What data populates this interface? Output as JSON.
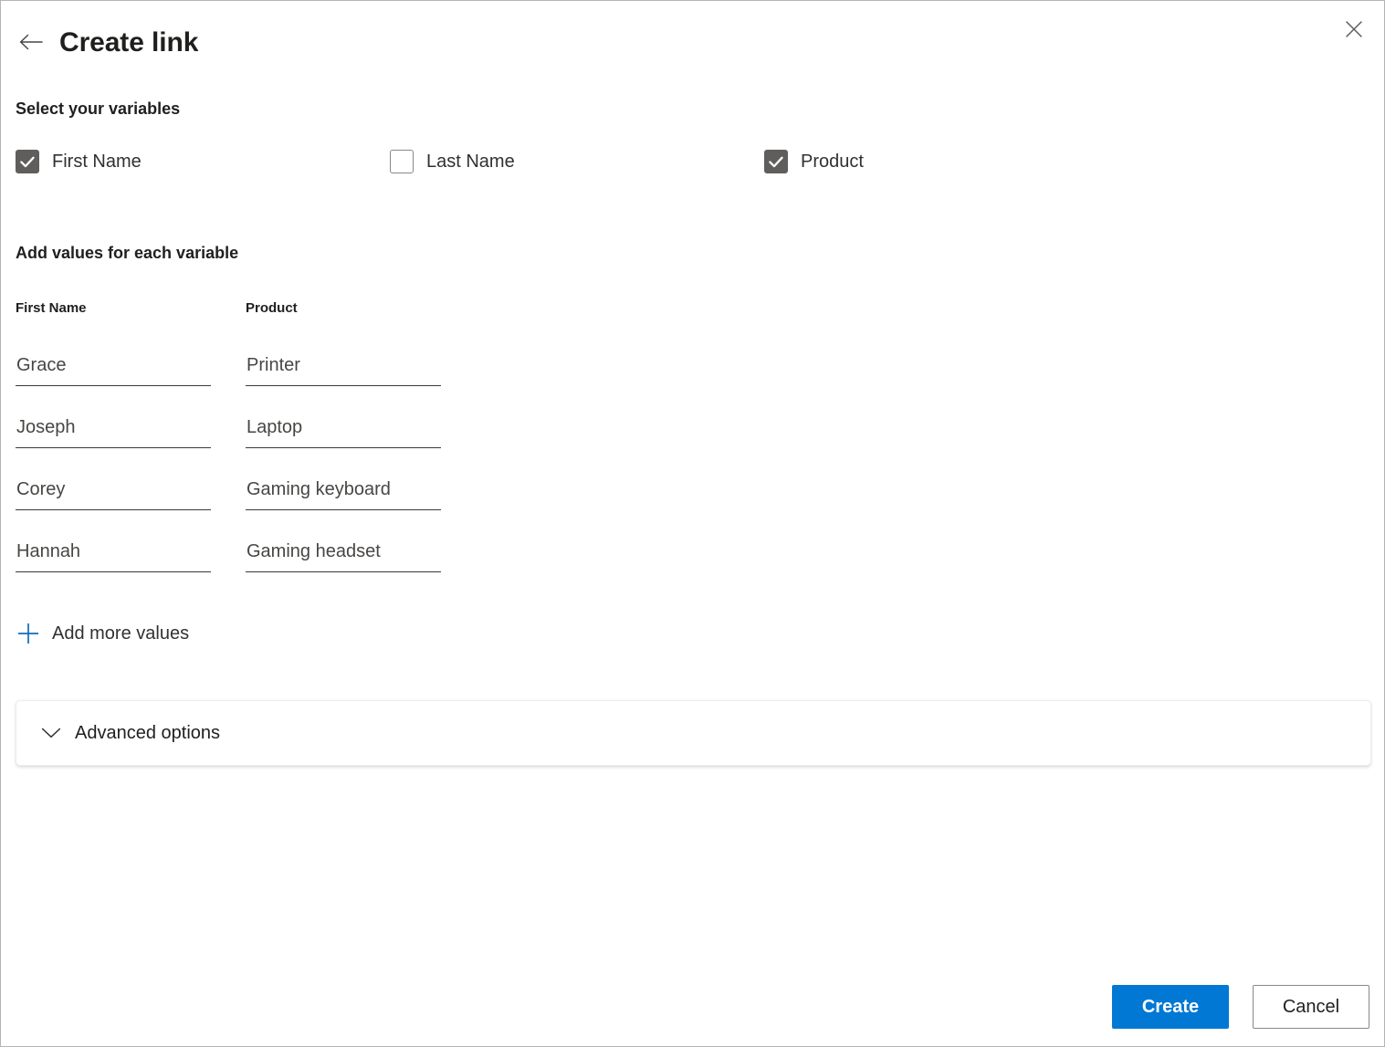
{
  "header": {
    "title": "Create link",
    "back_icon": "arrow-left-icon",
    "close_icon": "close-icon"
  },
  "variables_section": {
    "heading": "Select your variables",
    "checkboxes": [
      {
        "label": "First Name",
        "checked": true
      },
      {
        "label": "Last Name",
        "checked": false
      },
      {
        "label": "Product",
        "checked": true
      }
    ]
  },
  "values_section": {
    "heading": "Add values for each variable",
    "columns": [
      "First Name",
      "Product"
    ],
    "rows": [
      {
        "first_name": "Grace",
        "product": "Printer"
      },
      {
        "first_name": "Joseph",
        "product": "Laptop"
      },
      {
        "first_name": "Corey",
        "product": "Gaming keyboard"
      },
      {
        "first_name": "Hannah",
        "product": "Gaming headset"
      }
    ],
    "add_more_label": "Add more values",
    "add_more_icon": "plus-icon"
  },
  "advanced": {
    "label": "Advanced options",
    "chevron_icon": "chevron-down-icon",
    "expanded": false
  },
  "footer": {
    "create_label": "Create",
    "cancel_label": "Cancel"
  },
  "colors": {
    "accent": "#0078d4",
    "checkbox_fill": "#605e5c",
    "text_primary": "#201f1e",
    "text_secondary": "#484644",
    "border": "#8a8886"
  }
}
